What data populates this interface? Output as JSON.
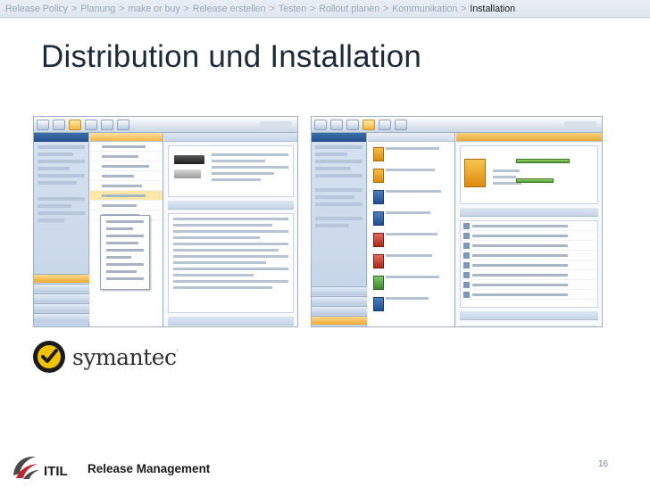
{
  "breadcrumb": [
    {
      "label": "Release Policy",
      "active": false
    },
    {
      "label": "Planung",
      "active": false
    },
    {
      "label": "make or buy",
      "active": false
    },
    {
      "label": "Release erstellen",
      "active": false
    },
    {
      "label": "Testen",
      "active": false
    },
    {
      "label": "Rollout planen",
      "active": false
    },
    {
      "label": "Kommunikation",
      "active": false
    },
    {
      "label": "Installation",
      "active": true
    }
  ],
  "breadcrumb_separator": ">",
  "slide": {
    "title": "Distribution und Installation",
    "page_number": "16"
  },
  "logos": {
    "symantec": {
      "name": "symantec",
      "tm": "."
    },
    "footer": {
      "itil": "ITIL",
      "label": "Release Management"
    }
  },
  "colors": {
    "breadcrumb_inactive": "#9aa8b8",
    "breadcrumb_active": "#1a1a1a",
    "title": "#1d2a3a",
    "symantec_yellow": "#f2c200",
    "itil_red": "#c0262d"
  }
}
